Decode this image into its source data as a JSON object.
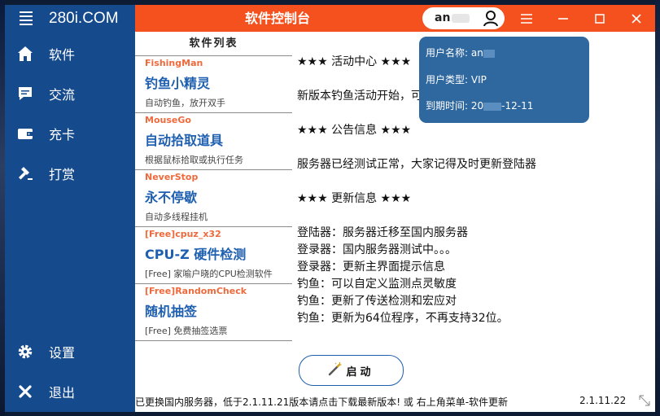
{
  "app": {
    "brand": "280i.COM",
    "title": "软件控制台"
  },
  "user": {
    "name_prefix": "an"
  },
  "sidebar": {
    "items": [
      {
        "label": "软件",
        "icon": "home-icon"
      },
      {
        "label": "交流",
        "icon": "chat-icon"
      },
      {
        "label": "充卡",
        "icon": "wallet-icon"
      },
      {
        "label": "打赏",
        "icon": "hammer-icon"
      },
      {
        "label": "设置",
        "icon": "gear-icon"
      },
      {
        "label": "退出",
        "icon": "close-icon"
      }
    ]
  },
  "software_list": {
    "header": "软件列表",
    "items": [
      {
        "tag": "FishingMan",
        "name": "钓鱼小精灵",
        "desc": "自动钓鱼，放开双手"
      },
      {
        "tag": "MouseGo",
        "name": "自动拾取道具",
        "desc": "根据鼠标拾取或执行任务"
      },
      {
        "tag": "NeverStop",
        "name": "永不停歇",
        "desc": "自动多线程挂机"
      },
      {
        "tag": "[Free]cpuz_x32",
        "name": "CPU-Z 硬件检测",
        "desc": "[Free] 家喻户晓的CPU检测软件"
      },
      {
        "tag": "[Free]RandomCheck",
        "name": "随机抽签",
        "desc": "[Free] 免费抽签选票"
      }
    ]
  },
  "content": {
    "activity_title": "★★★ 活动中心 ★★★",
    "activity_text": "新版本钓鱼活动开始，可以钓坐骑",
    "notice_title": "★★★ 公告信息 ★★★",
    "notice_text": "服务器已经测试正常，大家记得及时更新登陆器",
    "update_title": "★★★ 更新信息 ★★★",
    "updates": [
      "登陆器：服务器迁移至国内服务器",
      "登录器：国内服务器测试中。。。",
      "登录器：更新主界面提示信息",
      "钓鱼：可以自定义监测点灵敏度",
      "钓鱼：更新了传送检测和宏应对",
      "钓鱼：更新为64位程序，不再支持32位。"
    ]
  },
  "user_popup": {
    "name_label": "用户名称:",
    "name_value": "an",
    "type_label": "用户类型:",
    "type_value": "VIP",
    "expiry_label": "到期时间:",
    "expiry_prefix": "20",
    "expiry_suffix": "-12-11"
  },
  "launch_button": {
    "label": "启动"
  },
  "status": {
    "message": "已更换国内服务器，低于2.1.11.21版本请点击下载最新版本! 或 右上角菜单-软件更新",
    "version": "2.1.11.22"
  },
  "colors": {
    "sidebar": "#154a8d",
    "titlebar": "#f4511e",
    "popup": "#2f679f",
    "tag": "#ee6a3c",
    "tool_name": "#1e5fb0"
  }
}
